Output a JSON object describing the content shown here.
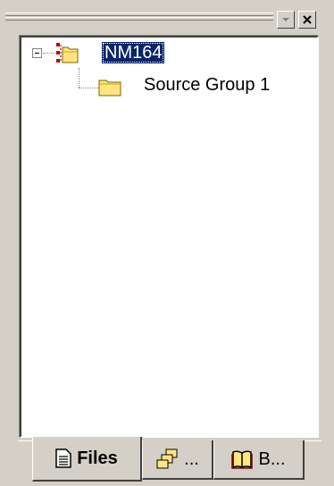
{
  "tree": {
    "project_label": "NM164",
    "group_label": "Source Group 1"
  },
  "tabs": [
    {
      "label": "Files",
      "icon": "files-icon",
      "active": true
    },
    {
      "label": "...",
      "icon": "regs-icon",
      "active": false
    },
    {
      "label": "B...",
      "icon": "books-icon",
      "active": false
    }
  ],
  "colors": {
    "face": "#d4d0c8",
    "selection": "#0a246a"
  }
}
